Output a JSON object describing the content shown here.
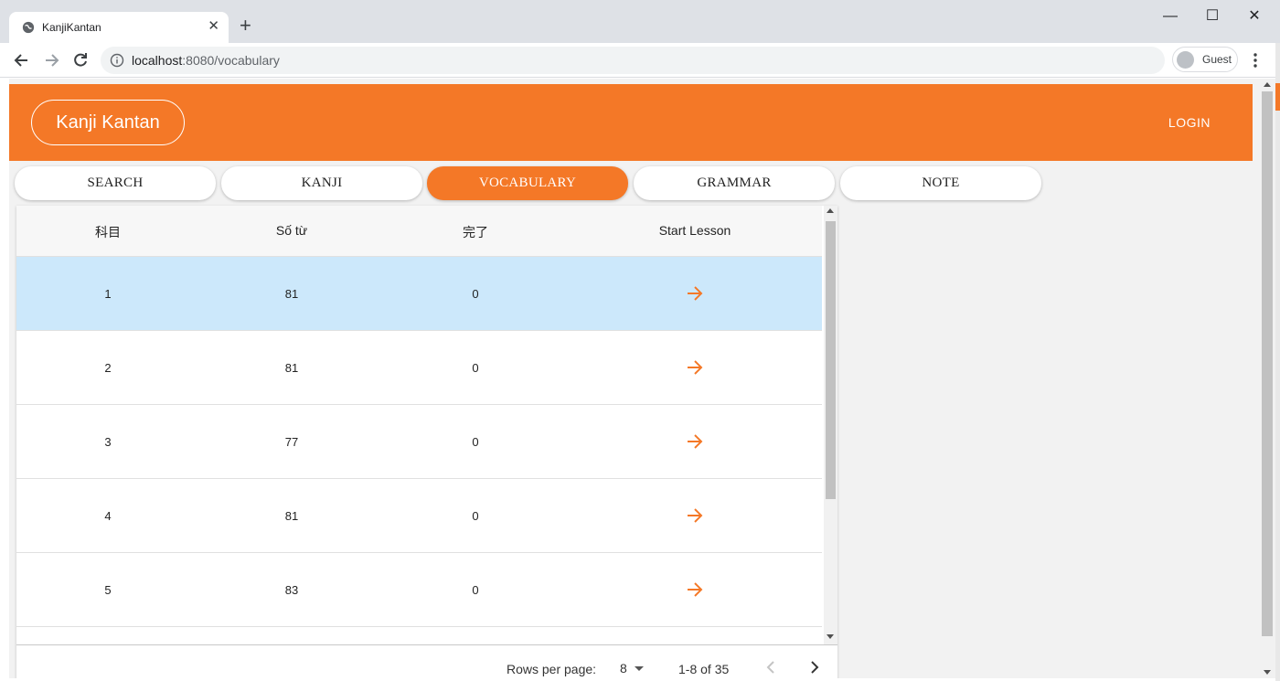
{
  "browser": {
    "tab_title": "KanjiKantan",
    "url_host": "localhost",
    "url_rest": ":8080/vocabulary",
    "profile_label": "Guest"
  },
  "header": {
    "brand": "Kanji Kantan",
    "login": "LOGIN"
  },
  "nav": {
    "tabs": [
      {
        "label": "SEARCH",
        "active": false
      },
      {
        "label": "KANJI",
        "active": false
      },
      {
        "label": "VOCABULARY",
        "active": true
      },
      {
        "label": "GRAMMAR",
        "active": false
      },
      {
        "label": "NOTE",
        "active": false
      }
    ]
  },
  "table": {
    "columns": [
      "科目",
      "Số từ",
      "完了",
      "Start Lesson"
    ],
    "rows": [
      {
        "subject": "1",
        "word_count": "81",
        "completed": "0",
        "selected": true
      },
      {
        "subject": "2",
        "word_count": "81",
        "completed": "0",
        "selected": false
      },
      {
        "subject": "3",
        "word_count": "77",
        "completed": "0",
        "selected": false
      },
      {
        "subject": "4",
        "word_count": "81",
        "completed": "0",
        "selected": false
      },
      {
        "subject": "5",
        "word_count": "83",
        "completed": "0",
        "selected": false
      }
    ],
    "footer": {
      "rows_per_page_label": "Rows per page:",
      "rows_per_page_value": "8",
      "page_range": "1-8 of 35"
    }
  },
  "colors": {
    "accent": "#f47827",
    "selected_row": "#cce8fb"
  },
  "icons": {
    "start_lesson": "arrow-right-icon",
    "prev": "chevron-left-icon",
    "next": "chevron-right-icon"
  }
}
